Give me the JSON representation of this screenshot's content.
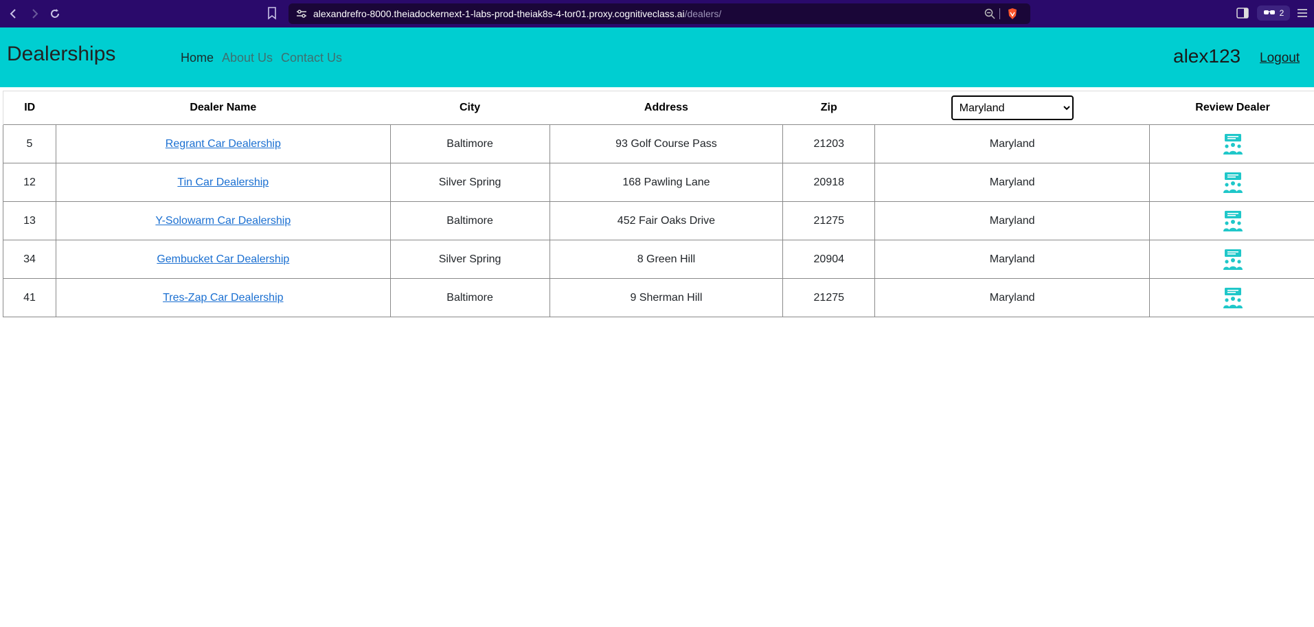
{
  "browser": {
    "url_host": "alexandrefro-8000.theiadockernext-1-labs-prod-theiak8s-4-tor01.proxy.cognitiveclass.ai",
    "url_path": "/dealers/",
    "extension_count": "2",
    "icons": [
      "back-arrow-icon",
      "forward-arrow-icon",
      "reload-icon",
      "bookmark-icon",
      "site-settings-icon",
      "zoom-icon",
      "brave-shield-icon",
      "sidebar-icon",
      "glasses-icon",
      "menu-icon"
    ]
  },
  "header": {
    "brand": "Dealerships",
    "nav": [
      {
        "label": "Home",
        "active": true
      },
      {
        "label": "About Us",
        "active": false
      },
      {
        "label": "Contact Us",
        "active": false
      }
    ],
    "username": "alex123",
    "logout_label": "Logout",
    "background_color": "#00ced1"
  },
  "table": {
    "columns": [
      "ID",
      "Dealer Name",
      "City",
      "Address",
      "Zip",
      "State",
      "Review Dealer"
    ],
    "state_filter": {
      "selected": "Maryland"
    },
    "rows": [
      {
        "id": "5",
        "name": "Regrant Car Dealership",
        "city": "Baltimore",
        "address": "93 Golf Course Pass",
        "zip": "21203",
        "state": "Maryland"
      },
      {
        "id": "12",
        "name": "Tin Car Dealership",
        "city": "Silver Spring",
        "address": "168 Pawling Lane",
        "zip": "20918",
        "state": "Maryland"
      },
      {
        "id": "13",
        "name": "Y-Solowarm Car Dealership",
        "city": "Baltimore",
        "address": "452 Fair Oaks Drive",
        "zip": "21275",
        "state": "Maryland"
      },
      {
        "id": "34",
        "name": "Gembucket Car Dealership",
        "city": "Silver Spring",
        "address": "8 Green Hill",
        "zip": "20904",
        "state": "Maryland"
      },
      {
        "id": "41",
        "name": "Tres-Zap Car Dealership",
        "city": "Baltimore",
        "address": "9 Sherman Hill",
        "zip": "21275",
        "state": "Maryland"
      }
    ],
    "review_icon": "review-dealer-icon",
    "link_color": "#1a6fd1"
  }
}
